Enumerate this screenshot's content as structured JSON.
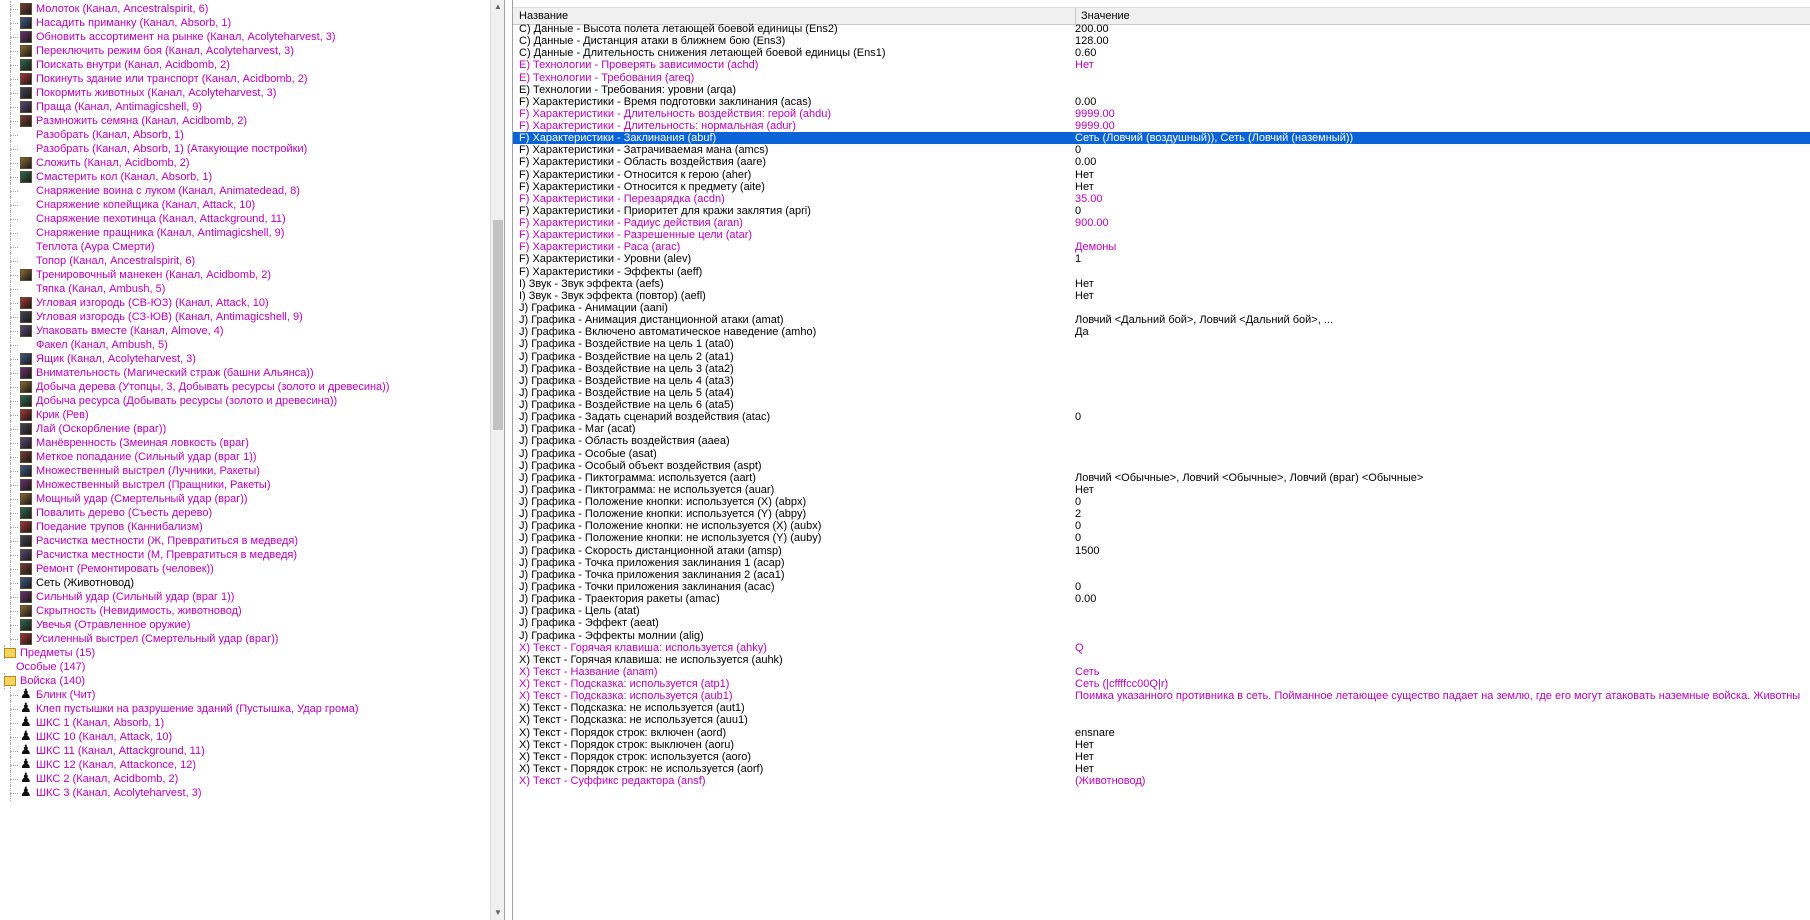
{
  "tree": {
    "items": [
      {
        "label": "Молоток (Канал, Ancestralspirit, 6)",
        "color": "m",
        "icon": "ability-icon"
      },
      {
        "label": "Насадить приманку (Канал, Absorb, 1)",
        "color": "m",
        "icon": "ability-icon"
      },
      {
        "label": "Обновить ассортимент на рынке (Канал, Acolyteharvest, 3)",
        "color": "m",
        "icon": "ability-icon"
      },
      {
        "label": "Переключить режим боя (Канал, Acolyteharvest, 3)",
        "color": "m",
        "icon": "ability-icon"
      },
      {
        "label": "Поискать внутри (Канал, Acidbomb, 2)",
        "color": "m",
        "icon": "ability-icon"
      },
      {
        "label": "Покинуть здание или транспорт (Канал, Acidbomb, 2)",
        "color": "m",
        "icon": "ability-icon"
      },
      {
        "label": "Покормить животных (Канал, Acolyteharvest, 3)",
        "color": "m",
        "icon": "ability-icon"
      },
      {
        "label": "Праща (Канал, Antimagicshell, 9)",
        "color": "m",
        "icon": "ability-icon"
      },
      {
        "label": "Размножить семяна (Канал, Acidbomb, 2)",
        "color": "m",
        "icon": "ability-icon"
      },
      {
        "label": "Разобрать (Канал, Absorb, 1)",
        "color": "m",
        "icon": ""
      },
      {
        "label": "Разобрать (Канал, Absorb, 1) (Атакующие постройки)",
        "color": "m",
        "icon": ""
      },
      {
        "label": "Сложить (Канал, Acidbomb, 2)",
        "color": "m",
        "icon": "ability-icon"
      },
      {
        "label": "Смастерить кол (Канал, Absorb, 1)",
        "color": "m",
        "icon": "ability-icon"
      },
      {
        "label": "Снаряжение воина с луком (Канал, Animatedead, 8)",
        "color": "m",
        "icon": ""
      },
      {
        "label": "Снаряжение копейщика (Канал, Attack, 10)",
        "color": "m",
        "icon": ""
      },
      {
        "label": "Снаряжение пехотинца (Канал, Attackground, 11)",
        "color": "m",
        "icon": ""
      },
      {
        "label": "Снаряжение пращника (Канал, Antimagicshell, 9)",
        "color": "m",
        "icon": ""
      },
      {
        "label": "Теплота (Аура Смерти)",
        "color": "m",
        "icon": ""
      },
      {
        "label": "Топор (Канал, Ancestralspirit, 6)",
        "color": "m",
        "icon": ""
      },
      {
        "label": "Тренировочный манекен (Канал, Acidbomb, 2)",
        "color": "m",
        "icon": "ability-icon"
      },
      {
        "label": "Тяпка (Канал, Ambush, 5)",
        "color": "m",
        "icon": ""
      },
      {
        "label": "Угловая изгородь (СВ-ЮЗ) (Канал, Attack, 10)",
        "color": "m",
        "icon": "ability-icon"
      },
      {
        "label": "Угловая изгородь (СЗ-ЮВ) (Канал, Antimagicshell, 9)",
        "color": "m",
        "icon": "ability-icon"
      },
      {
        "label": "Упаковать вместе (Канал, Almove, 4)",
        "color": "m",
        "icon": "ability-icon"
      },
      {
        "label": "Факел (Канал, Ambush, 5)",
        "color": "m",
        "icon": ""
      },
      {
        "label": "Ящик (Канал, Acolyteharvest, 3)",
        "color": "m",
        "icon": "ability-icon"
      },
      {
        "label": "Внимательность (Магический страж (башни Альянса))",
        "color": "m",
        "icon": "ability-icon"
      },
      {
        "label": "Добыча дерева (Утопцы, 3, Добывать ресурсы (золото и древесина))",
        "color": "m",
        "icon": "ability-icon"
      },
      {
        "label": "Добыча ресурса (Добывать ресурсы (золото и древесина))",
        "color": "m",
        "icon": "ability-icon"
      },
      {
        "label": "Крик (Рев)",
        "color": "m",
        "icon": "ability-icon"
      },
      {
        "label": "Лай (Оскорбление (враг))",
        "color": "m",
        "icon": "ability-icon"
      },
      {
        "label": "Манёвренность (Змеиная ловкость (враг)",
        "color": "m",
        "icon": "ability-icon"
      },
      {
        "label": "Меткое попадание (Сильный удар (враг 1))",
        "color": "m",
        "icon": "ability-icon"
      },
      {
        "label": "Множественный выстрел (Лучники, Ракеты)",
        "color": "m",
        "icon": "ability-icon"
      },
      {
        "label": "Множественный выстрел (Пращники, Ракеты)",
        "color": "m",
        "icon": "ability-icon"
      },
      {
        "label": "Мощный удар (Смертельный удар (враг))",
        "color": "m",
        "icon": "ability-icon"
      },
      {
        "label": "Повалить дерево (Съесть дерево)",
        "color": "m",
        "icon": "ability-icon"
      },
      {
        "label": "Поедание трупов (Каннибализм)",
        "color": "m",
        "icon": "ability-icon"
      },
      {
        "label": "Расчистка местности (Ж, Превратиться в медведя)",
        "color": "m",
        "icon": "ability-icon"
      },
      {
        "label": "Расчистка местности (М, Превратиться в медведя)",
        "color": "m",
        "icon": "ability-icon"
      },
      {
        "label": "Ремонт (Ремонтировать (человек))",
        "color": "m",
        "icon": "ability-icon"
      },
      {
        "label": "Сеть (Животновод)",
        "color": "b",
        "icon": "ability-icon"
      },
      {
        "label": "Сильный удар (Сильный удар (враг 1))",
        "color": "m",
        "icon": "ability-icon"
      },
      {
        "label": "Скрытность (Невидимость, животновод)",
        "color": "m",
        "icon": "ability-icon"
      },
      {
        "label": "Увечья (Отравленное оружие)",
        "color": "m",
        "icon": "ability-icon"
      },
      {
        "label": "Усиленный выстрел (Смертельный удар (враг))",
        "color": "m",
        "icon": "ability-icon"
      }
    ],
    "predmety": "Предметы (15)",
    "osobye": "Особые (147)",
    "voiska": "Войска (140)",
    "voiska_items": [
      "Блинк (Чит)",
      "Клеп пустышки на разрушение зданий (Пустышка, Удар грома)",
      "ШКС 1 (Канал, Absorb, 1)",
      "ШКС 10 (Канал, Attack, 10)",
      "ШКС 11 (Канал, Attackground, 11)",
      "ШКС 12 (Канал, Attackonce, 12)",
      "ШКС 2 (Канал, Acidbomb, 2)",
      "ШКС 3 (Канал, Acolyteharvest, 3)"
    ]
  },
  "grid": {
    "header": {
      "name": "Название",
      "value": "Значение"
    },
    "rows": [
      {
        "name": "C) Данные - Высота полета летающей боевой единицы (Ens2)",
        "value": "200.00",
        "c": "b"
      },
      {
        "name": "C) Данные - Дистанция атаки в ближнем бою (Ens3)",
        "value": "128.00",
        "c": "b"
      },
      {
        "name": "C) Данные - Длительность снижения летающей боевой единицы (Ens1)",
        "value": "0.60",
        "c": "b"
      },
      {
        "name": "E) Технологии - Проверять зависимости (achd)",
        "value": "Нет",
        "c": "m"
      },
      {
        "name": "E) Технологии - Требования (areq)",
        "value": "",
        "c": "m"
      },
      {
        "name": "E) Технологии - Требования: уровни (arqa)",
        "value": "",
        "c": "b"
      },
      {
        "name": "F) Характеристики - Время подготовки заклинания (acas)",
        "value": "0.00",
        "c": "b"
      },
      {
        "name": "F) Характеристики - Длительность воздействия: герой (ahdu)",
        "value": "9999.00",
        "c": "m"
      },
      {
        "name": "F) Характеристики - Длительность: нормальная (adur)",
        "value": "9999.00",
        "c": "m"
      },
      {
        "name": "F) Характеристики - Заклинания (abuf)",
        "value": "Сеть (Ловчий (воздушный)), Сеть (Ловчий (наземный))",
        "c": "sel"
      },
      {
        "name": "F) Характеристики - Затрачиваемая мана (amcs)",
        "value": "0",
        "c": "b"
      },
      {
        "name": "F) Характеристики - Область воздействия (aare)",
        "value": "0.00",
        "c": "b"
      },
      {
        "name": "F) Характеристики - Относится к герою (aher)",
        "value": "Нет",
        "c": "b"
      },
      {
        "name": "F) Характеристики - Относится к предмету (aite)",
        "value": "Нет",
        "c": "b"
      },
      {
        "name": "F) Характеристики - Перезарядка (acdn)",
        "value": "35.00",
        "c": "m"
      },
      {
        "name": "F) Характеристики - Приоритет для кражи заклятия (apri)",
        "value": "0",
        "c": "b"
      },
      {
        "name": "F) Характеристики - Радиус действия (aran)",
        "value": "900.00",
        "c": "m"
      },
      {
        "name": "F) Характеристики - Разрешенные цели (atar)",
        "value": "",
        "c": "m"
      },
      {
        "name": "F) Характеристики - Раса (arac)",
        "value": "Демоны",
        "c": "m"
      },
      {
        "name": "F) Характеристики - Уровни (alev)",
        "value": "1",
        "c": "b"
      },
      {
        "name": "F) Характеристики - Эффекты (aeff)",
        "value": "",
        "c": "b"
      },
      {
        "name": "I) Звук - Звук эффекта (aefs)",
        "value": "Нет",
        "c": "b"
      },
      {
        "name": "I) Звук - Звук эффекта (повтор) (aefl)",
        "value": "Нет",
        "c": "b"
      },
      {
        "name": "J) Графика - Анимации (aani)",
        "value": "",
        "c": "b"
      },
      {
        "name": "J) Графика - Анимация дистанционной атаки (amat)",
        "value": "Ловчий <Дальний бой>, Ловчий <Дальний бой>, ...",
        "c": "b"
      },
      {
        "name": "J) Графика - Включено автоматическое наведение (amho)",
        "value": "Да",
        "c": "b"
      },
      {
        "name": "J) Графика - Воздействие на цель 1 (ata0)",
        "value": "",
        "c": "b"
      },
      {
        "name": "J) Графика - Воздействие на цель 2 (ata1)",
        "value": "",
        "c": "b"
      },
      {
        "name": "J) Графика - Воздействие на цель 3 (ata2)",
        "value": "",
        "c": "b"
      },
      {
        "name": "J) Графика - Воздействие на цель 4 (ata3)",
        "value": "",
        "c": "b"
      },
      {
        "name": "J) Графика - Воздействие на цель 5 (ata4)",
        "value": "",
        "c": "b"
      },
      {
        "name": "J) Графика - Воздействие на цель 6 (ata5)",
        "value": "",
        "c": "b"
      },
      {
        "name": "J) Графика - Задать сценарий воздействия (atac)",
        "value": "0",
        "c": "b"
      },
      {
        "name": "J) Графика - Маг (acat)",
        "value": "",
        "c": "b"
      },
      {
        "name": "J) Графика - Область воздействия (aaea)",
        "value": "",
        "c": "b"
      },
      {
        "name": "J) Графика - Особые (asat)",
        "value": "",
        "c": "b"
      },
      {
        "name": "J) Графика - Особый объект воздействия (aspt)",
        "value": "",
        "c": "b"
      },
      {
        "name": "J) Графика - Пиктограмма: используется (aart)",
        "value": "Ловчий <Обычные>, Ловчий <Обычные>, Ловчий (враг) <Обычные>",
        "c": "b"
      },
      {
        "name": "J) Графика - Пиктограмма: не используется (auar)",
        "value": "Нет",
        "c": "b"
      },
      {
        "name": "J) Графика - Положение кнопки: используется (X) (abpx)",
        "value": "0",
        "c": "b"
      },
      {
        "name": "J) Графика - Положение кнопки: используется (Y) (abpy)",
        "value": "2",
        "c": "b"
      },
      {
        "name": "J) Графика - Положение кнопки: не используется (X) (aubx)",
        "value": "0",
        "c": "b"
      },
      {
        "name": "J) Графика - Положение кнопки: не используется (Y) (auby)",
        "value": "0",
        "c": "b"
      },
      {
        "name": "J) Графика - Скорость дистанционной атаки (amsp)",
        "value": "1500",
        "c": "b"
      },
      {
        "name": "J) Графика - Точка приложения заклинания 1 (acap)",
        "value": "",
        "c": "b"
      },
      {
        "name": "J) Графика - Точка приложения заклинания 2 (aca1)",
        "value": "",
        "c": "b"
      },
      {
        "name": "J) Графика - Точки приложения заклинания (acac)",
        "value": "0",
        "c": "b"
      },
      {
        "name": "J) Графика - Траектория ракеты (amac)",
        "value": "0.00",
        "c": "b"
      },
      {
        "name": "J) Графика - Цель (atat)",
        "value": "",
        "c": "b"
      },
      {
        "name": "J) Графика - Эффект (aeat)",
        "value": "",
        "c": "b"
      },
      {
        "name": "J) Графика - Эффекты молнии (alig)",
        "value": "",
        "c": "b"
      },
      {
        "name": "X) Текст - Горячая клавиша: используется (ahky)",
        "value": "Q",
        "c": "m"
      },
      {
        "name": "X) Текст - Горячая клавиша: не используется (auhk)",
        "value": "",
        "c": "b"
      },
      {
        "name": "X) Текст - Название (anam)",
        "value": "Сеть",
        "c": "m"
      },
      {
        "name": "X) Текст - Подсказка: используется (atp1)",
        "value": "Сеть (|cffffcc00Q|r)",
        "c": "m"
      },
      {
        "name": "X) Текст - Подсказка: используется (aub1)",
        "value": "Поимка указанного противника в сеть. Пойманное летающее существо падает на землю, где его могут атаковать наземные войска. Животны",
        "c": "m"
      },
      {
        "name": "X) Текст - Подсказка: не используется (aut1)",
        "value": "",
        "c": "b"
      },
      {
        "name": "X) Текст - Подсказка: не используется (auu1)",
        "value": "",
        "c": "b"
      },
      {
        "name": "X) Текст - Порядок строк: включен (aord)",
        "value": "ensnare",
        "c": "b"
      },
      {
        "name": "X) Текст - Порядок строк: выключен (aoru)",
        "value": "Нет",
        "c": "b"
      },
      {
        "name": "X) Текст - Порядок строк: используется (aoro)",
        "value": "Нет",
        "c": "b"
      },
      {
        "name": "X) Текст - Порядок строк: не используется (aorf)",
        "value": "Нет",
        "c": "b"
      },
      {
        "name": "X) Текст - Суффикс редактора (ansf)",
        "value": "(Животновод)",
        "c": "m"
      }
    ]
  },
  "colors": {
    "magenta": "#c000c0",
    "selection": "#0a64d8"
  }
}
